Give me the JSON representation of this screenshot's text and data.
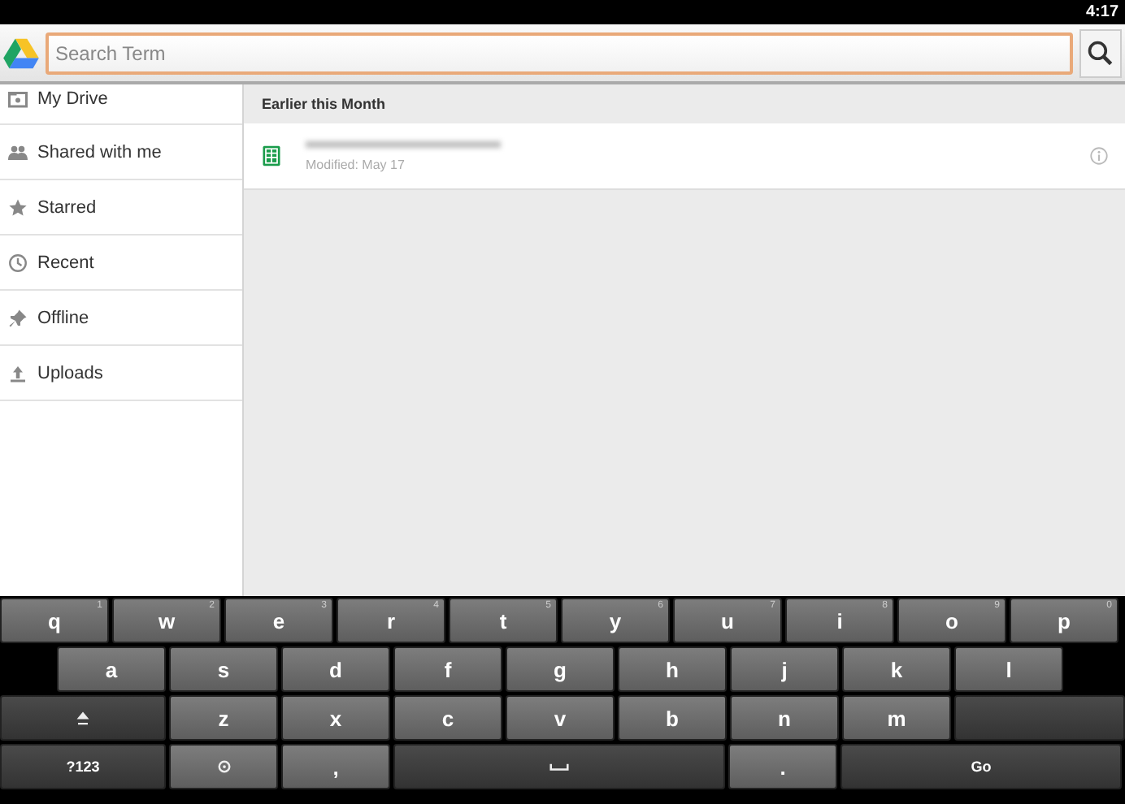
{
  "status_bar": {
    "time": "4:17"
  },
  "search": {
    "placeholder": "Search Term"
  },
  "sidebar": {
    "items": [
      {
        "label": "My Drive"
      },
      {
        "label": "Shared with me"
      },
      {
        "label": "Starred"
      },
      {
        "label": "Recent"
      },
      {
        "label": "Offline"
      },
      {
        "label": "Uploads"
      }
    ]
  },
  "files": {
    "section": "Earlier this Month",
    "items": [
      {
        "modified": "Modified: May 17"
      }
    ]
  },
  "keyboard": {
    "keys": [
      {
        "kind": "letter",
        "label": "q",
        "hint": "1"
      },
      {
        "kind": "letter",
        "label": "w",
        "hint": "2"
      },
      {
        "kind": "letter",
        "label": "e",
        "hint": "3"
      },
      {
        "kind": "letter",
        "label": "r",
        "hint": "4"
      },
      {
        "kind": "letter",
        "label": "t",
        "hint": "5"
      },
      {
        "kind": "letter",
        "label": "y",
        "hint": "6"
      },
      {
        "kind": "letter",
        "label": "u",
        "hint": "7"
      },
      {
        "kind": "letter",
        "label": "i",
        "hint": "8"
      },
      {
        "kind": "letter",
        "label": "o",
        "hint": "9"
      },
      {
        "kind": "letter",
        "label": "p",
        "hint": "0"
      },
      {
        "kind": "letter",
        "label": "a"
      },
      {
        "kind": "letter",
        "label": "s"
      },
      {
        "kind": "letter",
        "label": "d"
      },
      {
        "kind": "letter",
        "label": "f"
      },
      {
        "kind": "letter",
        "label": "g"
      },
      {
        "kind": "letter",
        "label": "h"
      },
      {
        "kind": "letter",
        "label": "j"
      },
      {
        "kind": "letter",
        "label": "k"
      },
      {
        "kind": "letter",
        "label": "l"
      },
      {
        "kind": "shift"
      },
      {
        "kind": "letter",
        "label": "z"
      },
      {
        "kind": "letter",
        "label": "x"
      },
      {
        "kind": "letter",
        "label": "c"
      },
      {
        "kind": "letter",
        "label": "v"
      },
      {
        "kind": "letter",
        "label": "b"
      },
      {
        "kind": "letter",
        "label": "n"
      },
      {
        "kind": "letter",
        "label": "m"
      },
      {
        "kind": "blank"
      },
      {
        "kind": "symbols",
        "label": "?123"
      },
      {
        "kind": "settings"
      },
      {
        "kind": "letter",
        "label": ","
      },
      {
        "kind": "space"
      },
      {
        "kind": "letter",
        "label": "."
      },
      {
        "kind": "go",
        "label": "Go"
      }
    ]
  }
}
